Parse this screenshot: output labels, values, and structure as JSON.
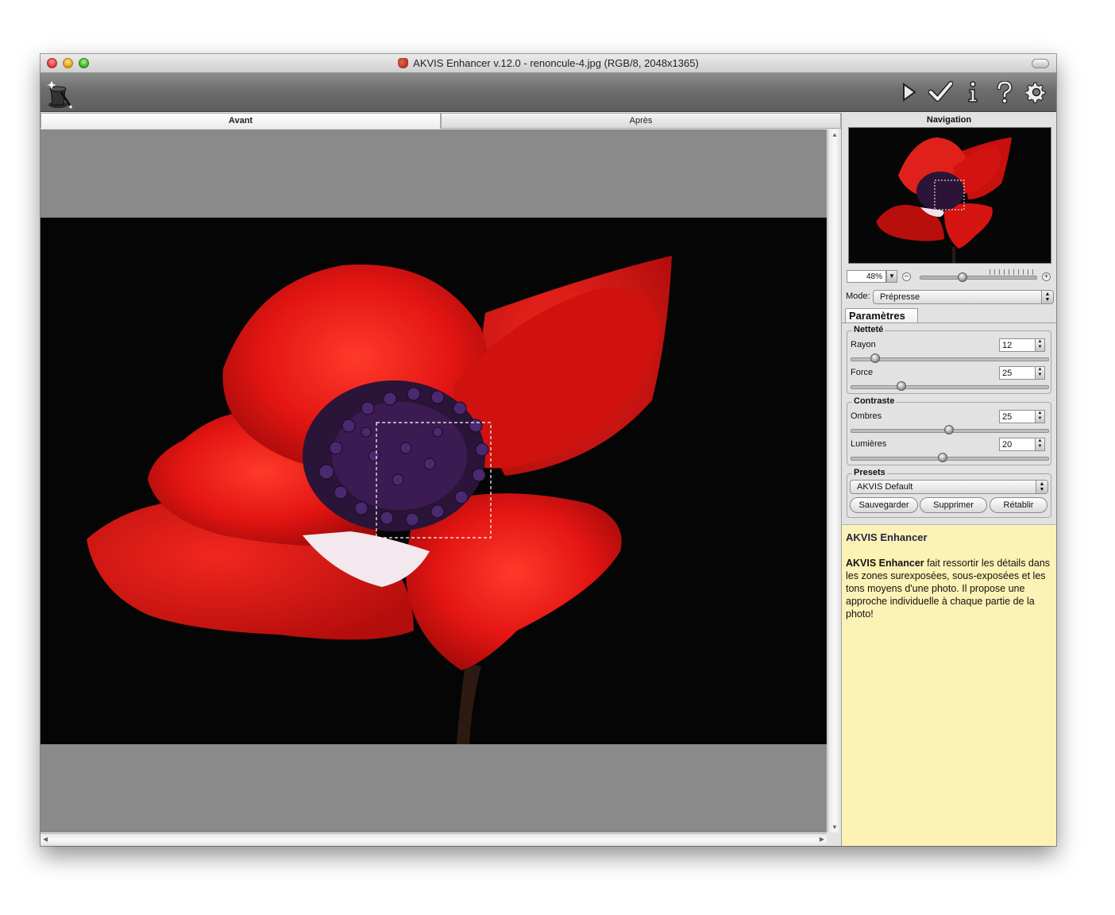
{
  "window": {
    "title": "AKVIS Enhancer v.12.0 - renoncule-4.jpg (RGB/8, 2048x1365)"
  },
  "toolbar": {
    "buttons": [
      {
        "name": "run-icon"
      },
      {
        "name": "apply-check-icon"
      },
      {
        "name": "info-icon"
      },
      {
        "name": "help-question-icon"
      },
      {
        "name": "preferences-gear-icon"
      }
    ]
  },
  "tabs": {
    "before": "Avant",
    "after": "Après"
  },
  "navigation": {
    "title": "Navigation",
    "zoom_value": "48%",
    "zoom_minus": "−",
    "zoom_plus": "+"
  },
  "mode": {
    "label": "Mode:",
    "value": "Prépresse"
  },
  "params": {
    "tab_label": "Paramètres",
    "sharpness": {
      "title": "Netteté",
      "radius_label": "Rayon",
      "radius_value": "12",
      "strength_label": "Force",
      "strength_value": "25"
    },
    "contrast": {
      "title": "Contraste",
      "shadows_label": "Ombres",
      "shadows_value": "25",
      "highlights_label": "Lumières",
      "highlights_value": "20"
    },
    "presets": {
      "title": "Presets",
      "selected": "AKVIS Default",
      "save_label": "Sauvegarder",
      "delete_label": "Supprimer",
      "reset_label": "Rétablir"
    }
  },
  "help": {
    "title": "AKVIS Enhancer",
    "bold_name": "AKVIS Enhancer",
    "body": " fait ressortir les détails dans les zones surexposées, sous-exposées et les tons moyens d'une photo. Il propose une approche individuelle à chaque partie de la photo!"
  },
  "colors": {
    "accent_red": "#e31513",
    "help_background": "#fdf2b5",
    "canvas_gray": "#8a8a8a"
  }
}
